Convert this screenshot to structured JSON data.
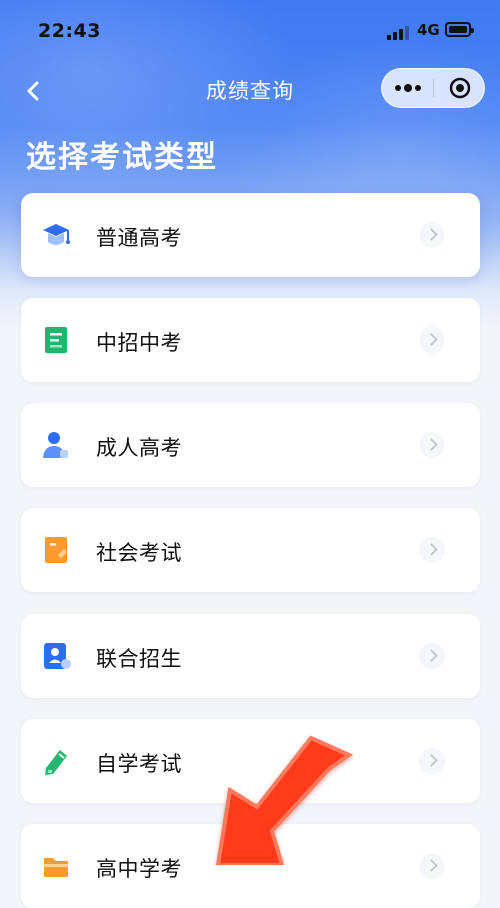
{
  "status_bar": {
    "time": "22:43",
    "network": "4G"
  },
  "nav": {
    "title": "成绩查询",
    "back_icon": "back-chevron-icon",
    "more_icon": "more-dots-icon",
    "close_icon": "target-close-icon"
  },
  "section": {
    "title": "选择考试类型"
  },
  "exam_types": [
    {
      "label": "普通高考",
      "icon": "graduation-cap-icon"
    },
    {
      "label": "中招中考",
      "icon": "green-document-icon"
    },
    {
      "label": "成人高考",
      "icon": "adult-user-icon"
    },
    {
      "label": "社会考试",
      "icon": "orange-document-icon"
    },
    {
      "label": "联合招生",
      "icon": "user-card-icon"
    },
    {
      "label": "自学考试",
      "icon": "pen-icon"
    },
    {
      "label": "高中学考",
      "icon": "orange-folder-icon"
    }
  ],
  "colors": {
    "header_blue": "#3f78f2",
    "background": "#f3f5f9",
    "card": "#ffffff",
    "text": "#111111",
    "annotation_arrow": "#ff3b1f"
  }
}
